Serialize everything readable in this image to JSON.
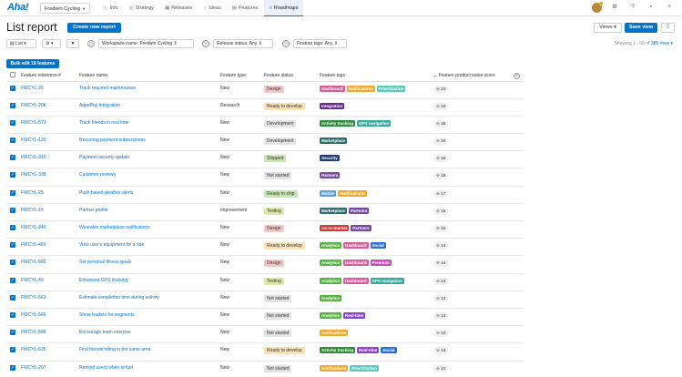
{
  "nav": {
    "logo": "Aha!",
    "workspace": "Fredwin Cycling",
    "tabs": [
      {
        "label": "Info",
        "icon": "ⓘ"
      },
      {
        "label": "Strategy",
        "icon": "◎"
      },
      {
        "label": "Releases",
        "icon": "▦"
      },
      {
        "label": "Ideas",
        "icon": "♁"
      },
      {
        "label": "Features",
        "icon": "▤"
      },
      {
        "label": "Roadmaps",
        "icon": "≡"
      }
    ],
    "active_tab": "Roadmaps"
  },
  "page": {
    "title": "List report",
    "create_button": "Create new report",
    "views_button": "Views ▾",
    "save_button": "Save view"
  },
  "filters": {
    "view_mode": "List",
    "workspace_filter": "Workspace name: Fredwin Cycling",
    "release_filter": "Release status: Any",
    "tags_filter": "Feature tags: Any",
    "showing_prefix": "Showing 1 - 50 of ",
    "showing_link": "385 rows ▾"
  },
  "bulk_button": "Bulk edit 18 features",
  "columns": {
    "ref": "Feature reference #",
    "name": "Feature name",
    "type": "Feature type",
    "status": "Feature status",
    "tags": "Feature tags",
    "score": "Feature product value score"
  },
  "colors": {
    "accent": "#0073cf",
    "status": {
      "Design": "#f4c7c7",
      "Ready to develop": "#fbe3b9",
      "Development": "#e3e3e3",
      "Shipped": "#c8e6b5",
      "Not started": "#e3e3e3",
      "Ready to ship": "#c8e6b5",
      "Testing": "#dbe8a8"
    },
    "tags": {
      "Dashboard": "#d65d9b",
      "Notifications": "#f0a830",
      "Prioritization": "#5ec8c0",
      "Integration": "#6c2c8c",
      "Activity tracking": "#2e8b3a",
      "GPS navigation": "#3aa89c",
      "Marketplace": "#2f6e6e",
      "Security": "#1f3b7a",
      "Partners": "#7a4a9c",
      "Mobile": "#5aa0e0",
      "Go-to-market": "#d23b3b",
      "Analytics": "#58b344",
      "Social": "#2c6fd0",
      "Premium": "#c94bb8",
      "Real-time": "#8a44c8"
    }
  },
  "rows": [
    {
      "ref": "FWCYL-26",
      "name": "Track required maintenance",
      "type": "New",
      "status": "Design",
      "tags": [
        "Dashboard",
        "Notifications",
        "Prioritization"
      ],
      "score": "22"
    },
    {
      "ref": "FWCYL-208",
      "name": "AppePay integration",
      "type": "Research",
      "status": "Ready to develop",
      "tags": [
        "Integration"
      ],
      "score": "19"
    },
    {
      "ref": "FWCYL-573",
      "name": "Track friends in real time",
      "type": "New",
      "status": "Development",
      "tags": [
        "Activity tracking",
        "GPS navigation"
      ],
      "score": "19"
    },
    {
      "ref": "FWCYL-120",
      "name": "Recurring payment subscriptions",
      "type": "New",
      "status": "Development",
      "tags": [
        "Marketplace"
      ],
      "score": "19"
    },
    {
      "ref": "FWCYL-310",
      "name": "Payment security update",
      "type": "New",
      "status": "Shipped",
      "tags": [
        "Security"
      ],
      "score": "18"
    },
    {
      "ref": "FWCYL-338",
      "name": "Customer reviews",
      "type": "New",
      "status": "Not started",
      "tags": [
        "Partners"
      ],
      "score": "18"
    },
    {
      "ref": "FWCYL-25",
      "name": "Push based weather alerts",
      "type": "New",
      "status": "Ready to ship",
      "tags": [
        "Mobile",
        "Notifications"
      ],
      "score": "17"
    },
    {
      "ref": "FWCYL-15",
      "name": "Partner profile",
      "type": "Improvement",
      "status": "Testing",
      "tags": [
        "Marketplace",
        "Partners"
      ],
      "score": "15"
    },
    {
      "ref": "FWCYL-340",
      "name": "Wearable marketplace notifications",
      "type": "New",
      "status": "Design",
      "tags": [
        "Go-to-market",
        "Partners"
      ],
      "score": "15"
    },
    {
      "ref": "FWCYL-463",
      "name": "View user's equipment for a ride",
      "type": "New",
      "status": "Ready to develop",
      "tags": [
        "Analytics",
        "Dashboard",
        "Social"
      ],
      "score": "14"
    },
    {
      "ref": "FWCYL-592",
      "name": "Set personal fitness goals",
      "type": "New",
      "status": "Design",
      "tags": [
        "Analytics",
        "Dashboard",
        "Premium"
      ],
      "score": "14"
    },
    {
      "ref": "FWCYL-49",
      "name": "Enhanced GPS tracking",
      "type": "New",
      "status": "Testing",
      "tags": [
        "Analytics",
        "Dashboard",
        "GPS navigation"
      ],
      "score": "14"
    },
    {
      "ref": "FWCYL-563",
      "name": "Estimate completion time during activity",
      "type": "New",
      "status": "Not started",
      "tags": [
        "Analytics"
      ],
      "score": "13"
    },
    {
      "ref": "FWCYL-566",
      "name": "Show leaders for segments",
      "type": "New",
      "status": "Not started",
      "tags": [
        "Analytics",
        "Real-time"
      ],
      "score": "13"
    },
    {
      "ref": "FWCYL-598",
      "name": "Encourage team exercise",
      "type": "New",
      "status": "Not started",
      "tags": [
        "Notifications"
      ],
      "score": "13"
    },
    {
      "ref": "FWCYL-635",
      "name": "Find friends riding in the same area",
      "type": "New",
      "status": "Ready to develop",
      "tags": [
        "Activity tracking",
        "Real-time",
        "Social"
      ],
      "score": "13"
    },
    {
      "ref": "FWCYL-207",
      "name": "Remind users when to fuel",
      "type": "New",
      "status": "Not started",
      "tags": [
        "Notifications",
        "Prioritization"
      ],
      "score": "12"
    }
  ]
}
